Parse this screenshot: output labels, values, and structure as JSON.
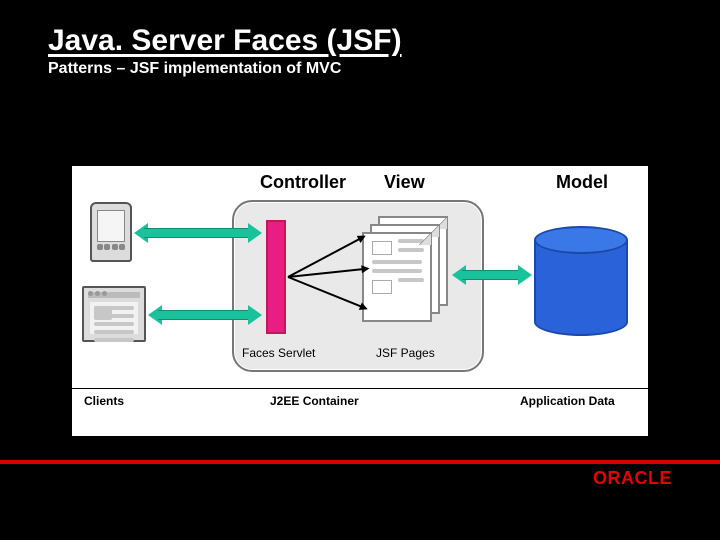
{
  "header": {
    "title": "Java. Server Faces (JSF)",
    "subtitle": "Patterns – JSF implementation of MVC"
  },
  "columns": {
    "controller": "Controller",
    "view": "View",
    "model": "Model"
  },
  "labels": {
    "faces_servlet": "Faces Servlet",
    "jsf_pages": "JSF Pages",
    "clients": "Clients",
    "j2ee_container": "J2EE Container",
    "application_data": "Application Data"
  },
  "footer": {
    "brand": "ORACLE"
  },
  "diagram": {
    "nodes": [
      {
        "id": "client-pda",
        "role": "client",
        "column": "clients"
      },
      {
        "id": "client-browser",
        "role": "client",
        "column": "clients"
      },
      {
        "id": "faces-servlet",
        "role": "controller",
        "column": "controller",
        "label_key": "labels.faces_servlet"
      },
      {
        "id": "jsf-pages",
        "role": "view",
        "column": "view",
        "label_key": "labels.jsf_pages"
      },
      {
        "id": "application-data",
        "role": "model",
        "column": "model",
        "label_key": "labels.application_data"
      }
    ],
    "arrows": [
      {
        "from": "client-pda",
        "to": "faces-servlet",
        "style": "bidirectional-green"
      },
      {
        "from": "client-browser",
        "to": "faces-servlet",
        "style": "bidirectional-green"
      },
      {
        "from": "faces-servlet",
        "to": "jsf-pages",
        "style": "thin-black",
        "count": 3
      },
      {
        "from": "jsf-pages",
        "to": "application-data",
        "style": "bidirectional-green"
      }
    ],
    "container": {
      "label_key": "labels.j2ee_container",
      "contains": [
        "faces-servlet",
        "jsf-pages"
      ]
    }
  }
}
